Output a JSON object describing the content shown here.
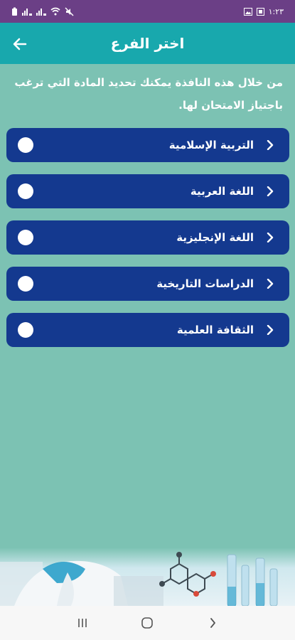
{
  "status_bar": {
    "time": "١:٢٣",
    "icons": [
      "battery-icon",
      "signal-icon",
      "signal-icon",
      "wifi-icon",
      "mute-icon",
      "image-icon",
      "notification-icon"
    ]
  },
  "app_bar": {
    "title": "اختر الفرع",
    "back_icon": "arrow-left-icon"
  },
  "description": "من خلال هذه النافذة يمكنك تحديد المادة التي ترغب باجتياز الامتحان لها.",
  "subjects": [
    {
      "label": "التربية الإسلامية",
      "selected": false
    },
    {
      "label": "اللغة العربية",
      "selected": false
    },
    {
      "label": "اللغة الإنجليزية",
      "selected": false
    },
    {
      "label": "الدراسات التاريخية",
      "selected": false
    },
    {
      "label": "الثقافة العلمية",
      "selected": false
    }
  ],
  "colors": {
    "status_bar": "#6b3f86",
    "app_bar": "#18a8ad",
    "background": "#7cc2b3",
    "item": "#14398f"
  },
  "nav": [
    "recent-apps-icon",
    "home-icon",
    "back-icon"
  ]
}
